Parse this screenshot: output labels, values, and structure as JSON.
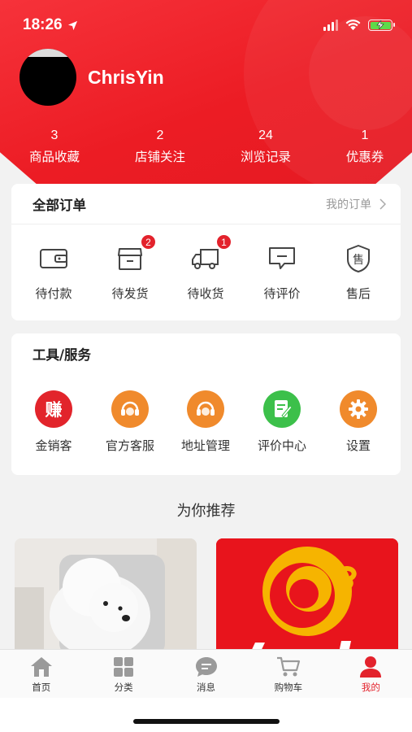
{
  "status_bar": {
    "time": "18:26"
  },
  "profile": {
    "username": "ChrisYin"
  },
  "stats": [
    {
      "value": "3",
      "label": "商品收藏"
    },
    {
      "value": "2",
      "label": "店铺关注"
    },
    {
      "value": "24",
      "label": "浏览记录"
    },
    {
      "value": "1",
      "label": "优惠券"
    }
  ],
  "orders": {
    "title": "全部订单",
    "link": "我的订单",
    "items": [
      {
        "label": "待付款",
        "icon": "wallet-icon"
      },
      {
        "label": "待发货",
        "icon": "box-icon",
        "badge": "2"
      },
      {
        "label": "待收货",
        "icon": "truck-icon",
        "badge": "1"
      },
      {
        "label": "待评价",
        "icon": "comment-icon"
      },
      {
        "label": "售后",
        "icon": "after-sale-icon"
      }
    ]
  },
  "services": {
    "title": "工具/服务",
    "items": [
      {
        "label": "金销客",
        "icon": "earn-icon",
        "glyph": "赚",
        "color": "#e2242b"
      },
      {
        "label": "官方客服",
        "icon": "support-icon",
        "color": "#f08a2c"
      },
      {
        "label": "地址管理",
        "icon": "address-icon",
        "color": "#f08a2c"
      },
      {
        "label": "评价中心",
        "icon": "review-icon",
        "color": "#3cc04a"
      },
      {
        "label": "设置",
        "icon": "gear-icon",
        "color": "#f08a2c"
      }
    ]
  },
  "recommend": {
    "title": "为你推荐"
  },
  "tabbar": {
    "items": [
      {
        "label": "首页",
        "icon": "home-icon"
      },
      {
        "label": "分类",
        "icon": "category-icon"
      },
      {
        "label": "消息",
        "icon": "message-icon"
      },
      {
        "label": "购物车",
        "icon": "cart-icon"
      },
      {
        "label": "我的",
        "icon": "profile-icon",
        "active": true
      }
    ]
  },
  "colors": {
    "brand": "#e41a22",
    "badge": "#e3222c",
    "tab_active": "#e3222c"
  }
}
